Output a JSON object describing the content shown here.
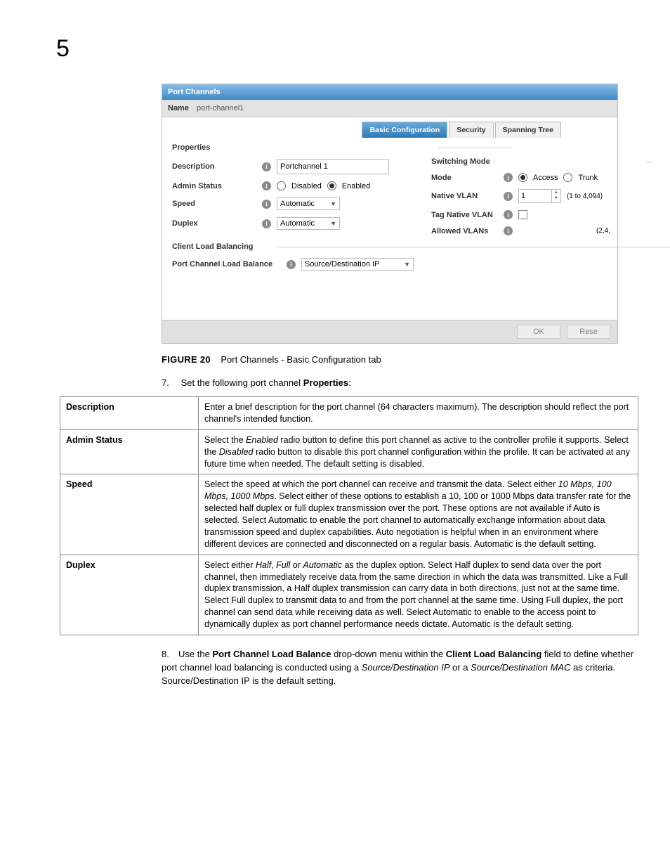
{
  "chapter": "5",
  "panel": {
    "title": "Port Channels",
    "name_label": "Name",
    "name_value": "port-channel1",
    "tabs": {
      "basic": "Basic Configuration",
      "security": "Security",
      "spanning": "Spanning Tree"
    },
    "properties": {
      "head": "Properties",
      "description_label": "Description",
      "description_value": "Portchannel 1",
      "admin_label": "Admin Status",
      "admin_disabled": "Disabled",
      "admin_enabled": "Enabled",
      "speed_label": "Speed",
      "speed_value": "Automatic",
      "duplex_label": "Duplex",
      "duplex_value": "Automatic"
    },
    "clb": {
      "head": "Client Load Balancing",
      "lb_label": "Port Channel Load Balance",
      "lb_value": "Source/Destination IP"
    },
    "switching": {
      "head": "Switching Mode",
      "mode_label": "Mode",
      "mode_access": "Access",
      "mode_trunk": "Trunk",
      "native_label": "Native VLAN",
      "native_value": "1",
      "native_hint": "(1 to 4,094)",
      "tag_label": "Tag Native VLAN",
      "allowed_label": "Allowed VLANs",
      "allowed_value": "(2,4,"
    },
    "footer": {
      "ok": "OK",
      "reset": "Rese"
    }
  },
  "figure": {
    "label": "FIGURE 20",
    "caption": "Port Channels - Basic Configuration tab"
  },
  "step7": {
    "num": "7.",
    "pre": "Set the following port channel ",
    "bold": "Properties",
    "post": ":"
  },
  "table": {
    "rows": [
      {
        "h": "Description",
        "d": "Enter a brief description for the port channel (64 characters maximum). The description should reflect the port channel's intended function."
      },
      {
        "h": "Admin Status",
        "d": "Select the <span class='ital'>Enabled</span> radio button to define this port channel as active to the controller profile it supports. Select the <span class='ital'>Disabled</span> radio button to disable this port channel configuration within the profile. It can be activated at any future time when needed. The default setting is disabled."
      },
      {
        "h": "Speed",
        "d": "Select the speed at which the port channel can receive and transmit the data. Select either <span class='ital'>10 Mbps, 100 Mbps, 1000 Mbps</span>. Select either of these options to establish a 10, 100 or 1000 Mbps data transfer rate for the selected half duplex or full duplex transmission over the port. These options are not available if Auto is selected. Select Automatic to enable the port channel to automatically exchange information about data transmission speed and duplex capabilities. Auto negotiation is helpful when in an environment where different devices are connected and disconnected on a regular basis. Automatic is the default setting."
      },
      {
        "h": "Duplex",
        "d": "Select either <span class='ital'>Half</span>, <span class='ital'>Full</span> or <span class='ital'>Automatic</span> as the duplex option. Select Half duplex to send data over the port channel, then immediately receive data from the same direction in which the data was transmitted. Like a Full duplex transmission, a Half duplex transmission can carry data in both directions, just not at the same time. Select Full duplex to transmit data to and from the port channel at the same time. Using Full duplex, the port channel can send data while receiving data as well. Select Automatic to enable to the access point to dynamically duplex as port channel performance needs dictate. Automatic is the default setting."
      }
    ]
  },
  "step8": {
    "num": "8.",
    "parts": [
      "Use the ",
      "Port Channel Load Balance",
      " drop-down menu within the ",
      "Client Load Balancing",
      " field to define whether port channel load balancing is conducted using a ",
      "Source/Destination IP",
      " or a ",
      "Source/Destination MAC",
      " as criteria. Source/Destination IP is the default setting."
    ]
  }
}
